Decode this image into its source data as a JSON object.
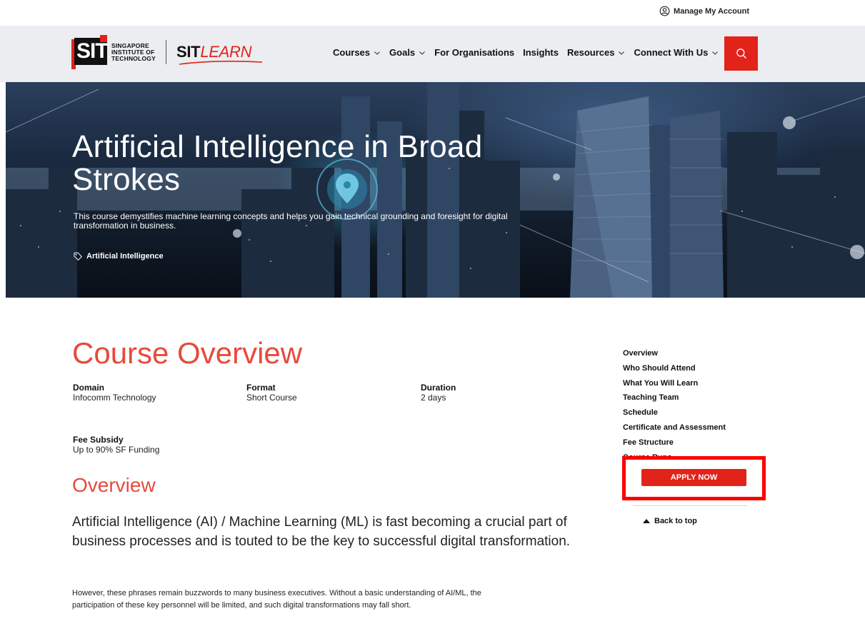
{
  "utility": {
    "account_label": "Manage My Account"
  },
  "logo": {
    "sit_mark": "SIT",
    "words": [
      "SINGAPORE",
      "INSTITUTE OF",
      "TECHNOLOGY"
    ],
    "sitlearn_sit": "SIT",
    "sitlearn_learn": "LEARN"
  },
  "nav": {
    "items": [
      {
        "label": "Courses",
        "dropdown": true
      },
      {
        "label": "Goals",
        "dropdown": true
      },
      {
        "label": "For Organisations",
        "dropdown": false
      },
      {
        "label": "Insights",
        "dropdown": false
      },
      {
        "label": "Resources",
        "dropdown": true
      },
      {
        "label": "Connect With Us",
        "dropdown": true
      }
    ]
  },
  "hero": {
    "title": "Artificial Intelligence in Broad Strokes",
    "description": "This course demystifies machine learning concepts and helps you gain technical grounding and foresight for digital transformation in business.",
    "tag": "Artificial Intelligence"
  },
  "course_overview": {
    "title": "Course Overview",
    "domain_label": "Domain",
    "domain_value": "Infocomm Technology",
    "format_label": "Format",
    "format_value": "Short Course",
    "duration_label": "Duration",
    "duration_value": "2 days",
    "fee_label": "Fee Subsidy",
    "fee_value": "Up to 90% SF Funding"
  },
  "overview": {
    "heading": "Overview",
    "lead": "Artificial Intelligence (AI) / Machine Learning (ML) is fast becoming a crucial part of business processes and is touted to be the key to successful digital transformation.",
    "body": "However, these phrases remain buzzwords to many business executives. Without a basic understanding of AI/ML, the participation of these key personnel will be limited, and such digital transformations may fall short."
  },
  "sidebar": {
    "links": [
      "Overview",
      "Who Should Attend",
      "What You Will Learn",
      "Teaching Team",
      "Schedule",
      "Certificate and Assessment",
      "Fee Structure",
      "Course Runs"
    ],
    "apply_label": "APPLY NOW",
    "back_to_top": "Back to top"
  },
  "colors": {
    "brand_red": "#e2231a",
    "heading_red": "#e74a3b",
    "highlight_red": "#ff0000",
    "header_bg": "#ebedf0"
  }
}
